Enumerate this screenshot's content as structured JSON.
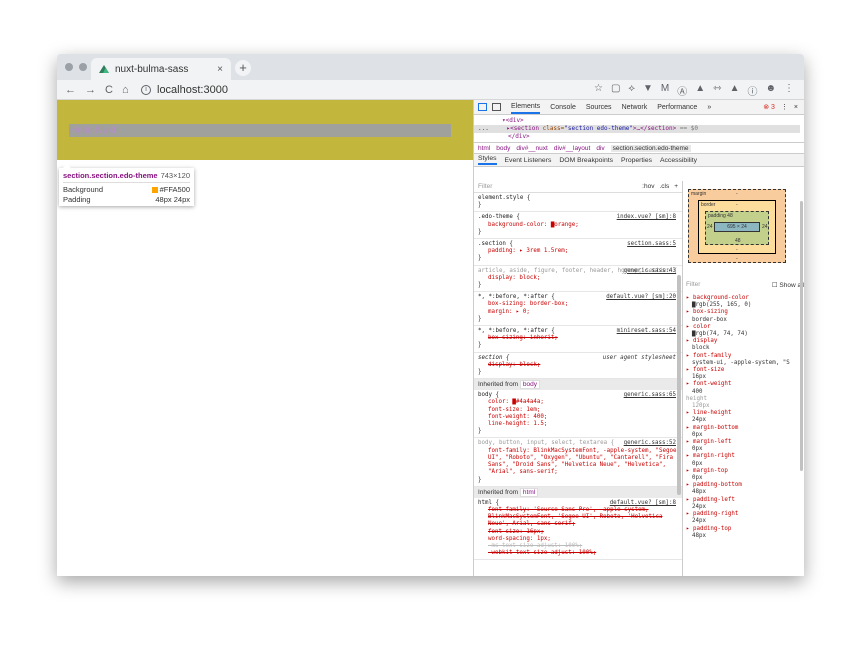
{
  "browser": {
    "tab_title": "nuxt-bulma-sass",
    "tab_close": "×",
    "new_tab": "+",
    "url": "localhost:3000",
    "nav": {
      "back": "←",
      "forward": "→",
      "reload": "C",
      "home": "⌂",
      "info": "i"
    },
    "extensions": [
      "☆",
      "▢",
      "⟡",
      "▼",
      "M",
      "Ⓐ",
      "▲",
      "⇿",
      "▲",
      "ⓘ",
      "☻",
      "⋮"
    ]
  },
  "viewport": {
    "hello_text": "Hello Nuxt!",
    "section_color": "#c2b63d"
  },
  "tooltip": {
    "selector": "section.section.edo-theme",
    "dimensions": "743×120",
    "rows": [
      {
        "label": "Background",
        "value": "#FFA500"
      },
      {
        "label": "Padding",
        "value": "48px 24px"
      }
    ]
  },
  "devtools": {
    "tabs": [
      "Elements",
      "Console",
      "Sources",
      "Network",
      "Performance",
      "»"
    ],
    "error_count": "3",
    "menu": "⋮",
    "close": "×",
    "dom": {
      "line1_tag": "▾<div>",
      "line2_open": "▸<section ",
      "line2_attr": "class=",
      "line2_val": "\"section edo-theme\"",
      "line2_close": ">…</section>",
      "line2_eq": " == $0",
      "line3_tag": "</div>",
      "ellipsis": "..."
    },
    "breadcrumbs": [
      "html",
      "body",
      "div#__nuxt",
      "div#__layout",
      "div",
      "section.section.edo-theme"
    ],
    "sub_tabs": [
      "Styles",
      "Event Listeners",
      "DOM Breakpoints",
      "Properties",
      "Accessibility"
    ],
    "filter_placeholder": "Filter",
    "filter_hov": ":hov",
    "filter_cls": ".cls",
    "filter_plus": "+",
    "rules": [
      {
        "selector": "element.style {",
        "source": "",
        "props": [],
        "close": "}"
      },
      {
        "selector": ".edo-theme {",
        "source": "index.vue? [sm]:8",
        "props": [
          "background-color: ▇orange;"
        ],
        "close": "}"
      },
      {
        "selector": ".section {",
        "source": "section.sass:5",
        "props": [
          "padding: ▸ 3rem 1.5rem;"
        ],
        "close": "}"
      },
      {
        "selector": "article, aside, figure, footer, header, hgroup, section {",
        "source": "generic.sass:43",
        "props": [
          "display: block;"
        ],
        "close": "}"
      },
      {
        "selector": "*, *:before, *:after {",
        "source": "default.vue? [sm]:20",
        "props": [
          "box-sizing: border-box;",
          "margin: ▸ 0;"
        ],
        "close": "}"
      },
      {
        "selector": "*, *:before, *:after {",
        "source": "minireset.sass:54",
        "props": [
          "box-sizing: inherit;"
        ],
        "close": "}"
      },
      {
        "selector": "section {",
        "source": "user agent stylesheet",
        "props": [
          "display: block;"
        ],
        "close": "}"
      }
    ],
    "inherited_body_label": "Inherited from",
    "inherited_body_tag": "body",
    "body_rule": {
      "selector": "body {",
      "source": "generic.sass:65",
      "props": [
        "color: ▇#4a4a4a;",
        "font-size: 1em;",
        "font-weight: 400;",
        "line-height: 1.5;"
      ],
      "close": "}"
    },
    "body2_rule": {
      "selector": "body, button, input, select, textarea {",
      "source": "generic.sass:52",
      "props": [
        "font-family: BlinkMacSystemFont, -apple-system, \"Segoe UI\", \"Roboto\", \"Oxygen\", \"Ubuntu\", \"Cantarell\", \"Fira Sans\", \"Droid Sans\", \"Helvetica Neue\", \"Helvetica\", \"Arial\", sans-serif;"
      ],
      "close": "}"
    },
    "inherited_html_label": "Inherited from",
    "inherited_html_tag": "html",
    "html_rule": {
      "selector": "html {",
      "source": "default.vue? [sm]:8",
      "props": [
        "font-family: 'Source Sans Pro', -apple-system, BlinkMacSystemFont, 'Segoe UI', Roboto, 'Helvetica Neue', Arial, sans-serif;",
        "font-size: 16px;",
        "word-spacing: 1px;",
        "-ms-text-size-adjust: 100%;",
        "-webkit-text-size-adjust: 100%;"
      ]
    },
    "boxmodel": {
      "margin": "margin",
      "margin_val": "-",
      "border": "border",
      "border_val": "-",
      "padding": "padding 48",
      "content": "695 × 24",
      "left": "24",
      "right": "24",
      "bottom": "48",
      "border_bottom": "-",
      "margin_bottom": "-"
    },
    "computed_filter": "Filter",
    "show_all": "Show all",
    "computed": [
      {
        "prop": "▸ background-color",
        "val": "▇rgb(255, 165, 0)"
      },
      {
        "prop": "▸ box-sizing",
        "val": "border-box"
      },
      {
        "prop": "▸ color",
        "val": "▇rgb(74, 74, 74)"
      },
      {
        "prop": "▸ display",
        "val": "block"
      },
      {
        "prop": "▸ font-family",
        "val": "system-ui, -apple-system, \"S"
      },
      {
        "prop": "▸ font-size",
        "val": "16px"
      },
      {
        "prop": "▸ font-weight",
        "val": "400"
      },
      {
        "prop": "height",
        "val": "120px",
        "dim": true
      },
      {
        "prop": "▸ line-height",
        "val": "24px"
      },
      {
        "prop": "▸ margin-bottom",
        "val": "0px"
      },
      {
        "prop": "▸ margin-left",
        "val": "0px"
      },
      {
        "prop": "▸ margin-right",
        "val": "0px"
      },
      {
        "prop": "▸ margin-top",
        "val": "0px"
      },
      {
        "prop": "▸ padding-bottom",
        "val": "48px"
      },
      {
        "prop": "▸ padding-left",
        "val": "24px"
      },
      {
        "prop": "▸ padding-right",
        "val": "24px"
      },
      {
        "prop": "▸ padding-top",
        "val": "48px"
      }
    ]
  }
}
